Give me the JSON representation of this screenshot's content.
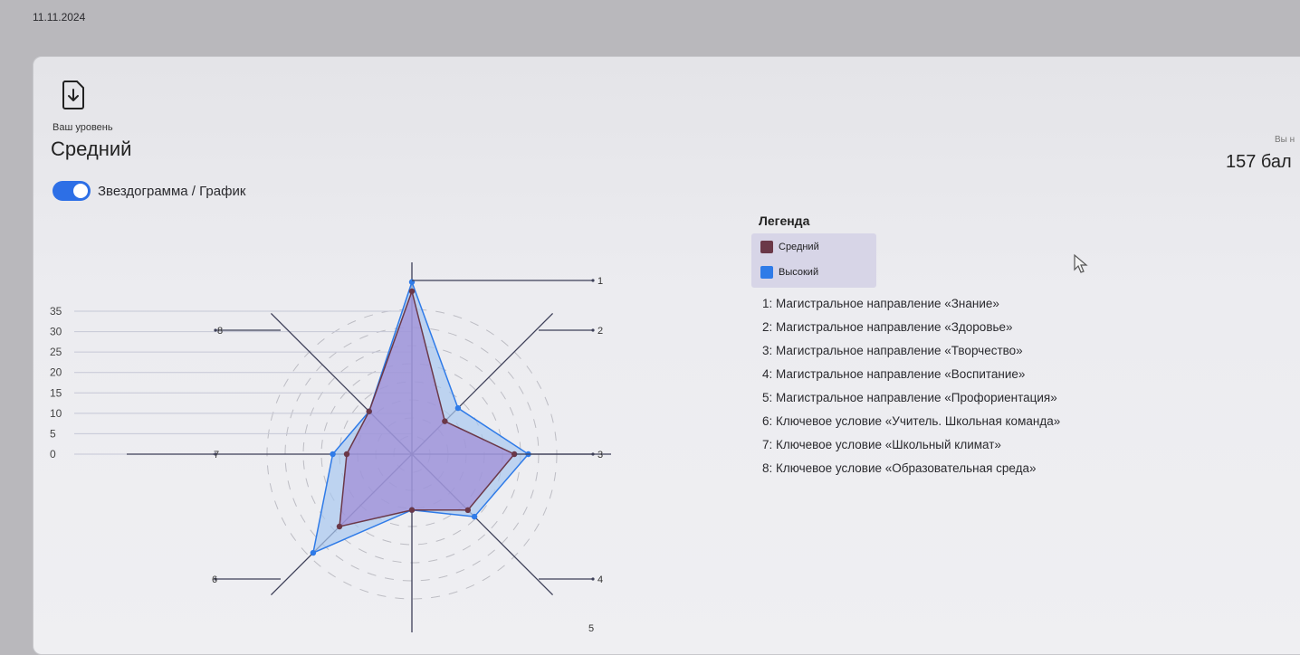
{
  "date": "11.11.2024",
  "level": {
    "label": "Ваш уровень",
    "value": "Средний"
  },
  "score": {
    "caption_fragment": "Вы н",
    "value_fragment": "157 бал"
  },
  "toggle": {
    "label": "Звездограмма / График",
    "on": true
  },
  "legend": {
    "title": "Легенда",
    "items": [
      {
        "label": "Средний",
        "color": "#6b3848"
      },
      {
        "label": "Высокий",
        "color": "#2f7be8"
      }
    ]
  },
  "axes": [
    "1: Магистральное направление «Знание»",
    "2: Магистральное направление «Здоровье»",
    "3: Магистральное направление «Творчество»",
    "4: Магистральное направление «Воспитание»",
    "5: Магистральное направление «Профориентация»",
    "6: Ключевое условие «Учитель. Школьная команда»",
    "7: Ключевое условие «Школьный климат»",
    "8: Ключевое условие «Образовательная среда»"
  ],
  "chart_data": {
    "type": "radar",
    "axis_numbers": [
      "1",
      "2",
      "3",
      "4",
      "5",
      "6",
      "7",
      "8"
    ],
    "scale_ticks": [
      "35",
      "30",
      "25",
      "20",
      "15",
      "10",
      "5",
      "0"
    ],
    "scale_values": [
      35,
      30,
      25,
      20,
      15,
      10,
      5,
      0
    ],
    "max": 35,
    "series": [
      {
        "name": "Средний",
        "color": "#6b3848",
        "fill": "#9b7fd0",
        "values": [
          35,
          10,
          22,
          17,
          12,
          22,
          14,
          13
        ]
      },
      {
        "name": "Высокий",
        "color": "#2f7be8",
        "fill": "#a8c8f0",
        "values": [
          37,
          14,
          25,
          19,
          12,
          30,
          17,
          13
        ]
      }
    ]
  }
}
